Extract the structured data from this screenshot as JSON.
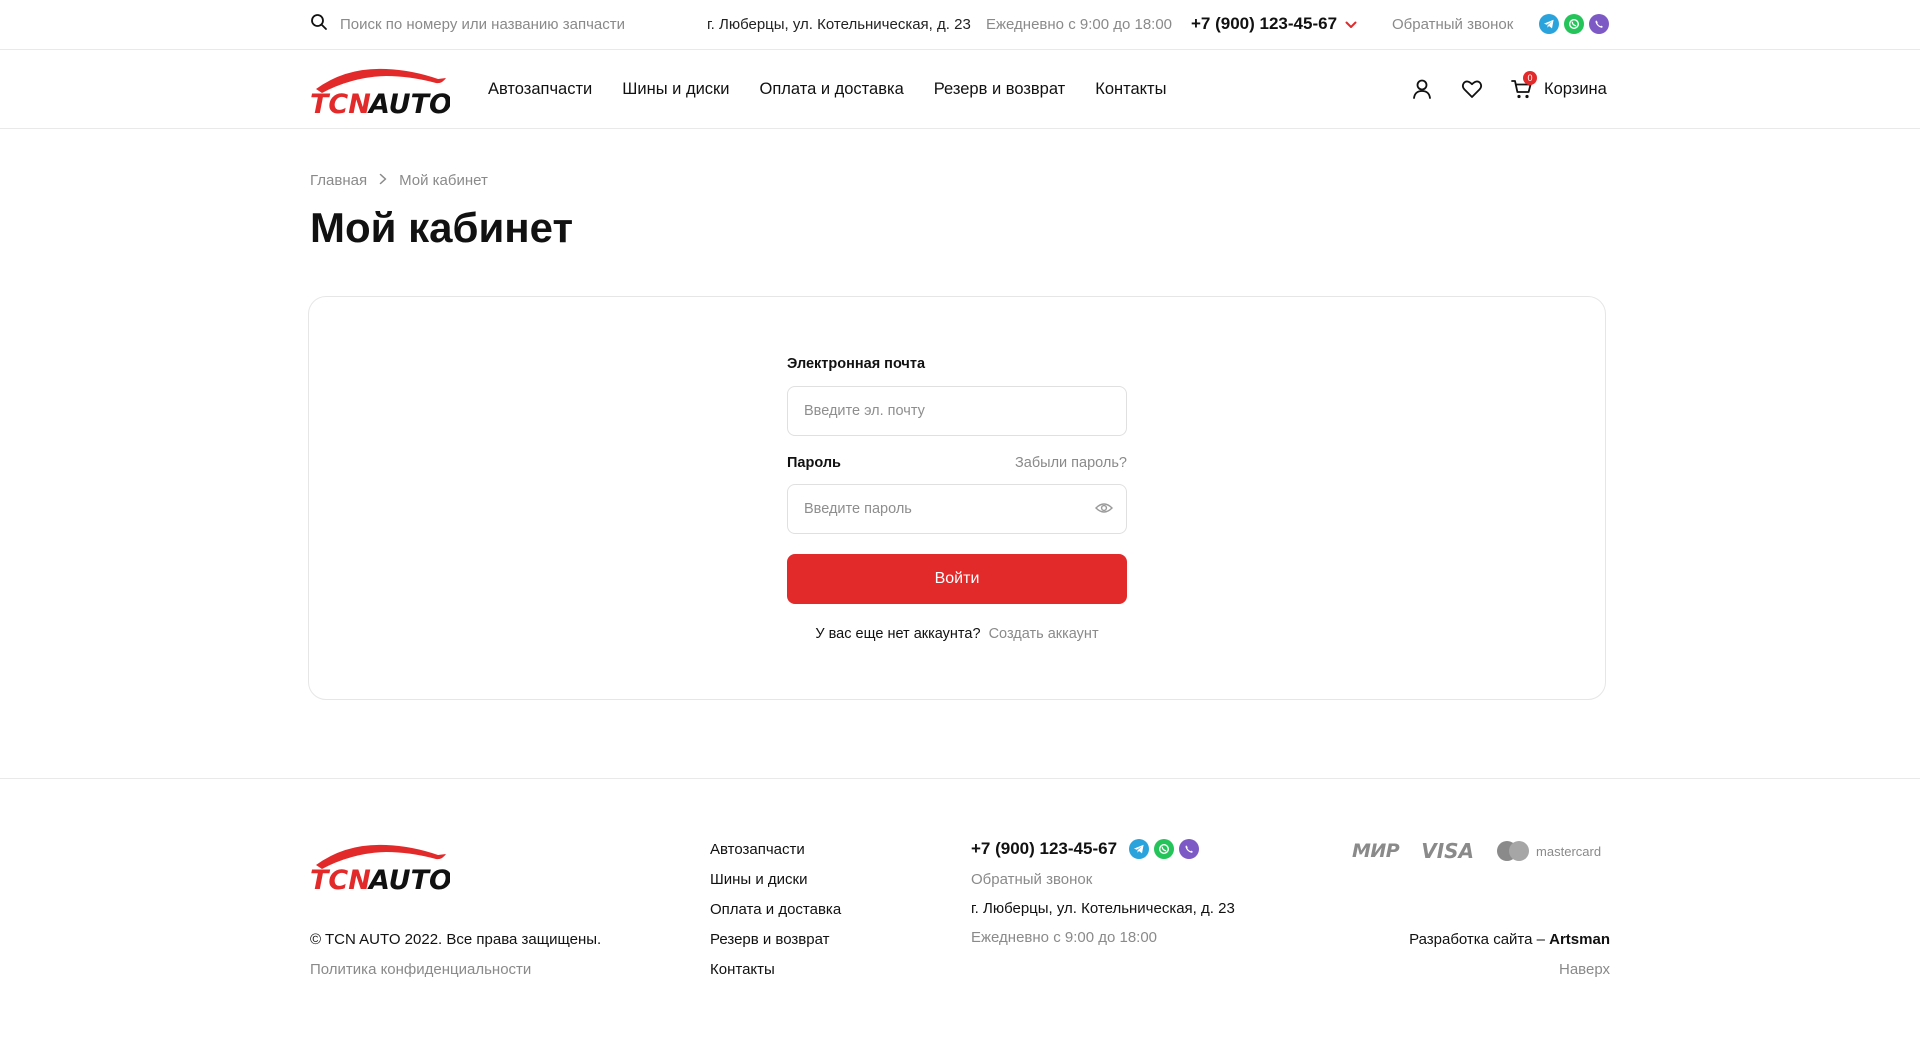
{
  "topbar": {
    "search_placeholder": "Поиск по номеру или названию запчасти",
    "address": "г. Люберцы, ул. Котельническая, д. 23",
    "hours": "Ежедневно с 9:00 до 18:00",
    "phone": "+7 (900) 123-45-67",
    "callback": "Обратный звонок",
    "socials": [
      "telegram-icon",
      "whatsapp-icon",
      "viber-icon"
    ]
  },
  "brand": {
    "logo_text": "TCNAUTO",
    "accent_color": "#e32a2a"
  },
  "nav": {
    "items": [
      "Автозапчасти",
      "Шины и диски",
      "Оплата и доставка",
      "Резерв и возврат",
      "Контакты"
    ]
  },
  "header": {
    "cart_label": "Корзина",
    "cart_count": "0"
  },
  "breadcrumb": {
    "home": "Главная",
    "current": "Мой кабинет"
  },
  "page": {
    "title": "Мой кабинет"
  },
  "login": {
    "email_label": "Электронная почта",
    "email_placeholder": "Введите эл. почту",
    "password_label": "Пароль",
    "forgot_link": "Забыли пароль?",
    "password_placeholder": "Введите пароль",
    "submit_label": "Войти",
    "no_account_text": "У вас еще нет аккаунта?",
    "create_account_link": "Создать аккаунт"
  },
  "footer": {
    "copyright": "© TCN AUTO 2022. Все права защищены.",
    "policy": "Политика конфиденциальности",
    "nav": [
      "Автозапчасти",
      "Шины и диски",
      "Оплата и доставка",
      "Резерв и возврат",
      "Контакты"
    ],
    "phone": "+7 (900) 123-45-67",
    "callback": "Обратный звонок",
    "address": "г. Люберцы, ул. Котельническая, д. 23",
    "hours": "Ежедневно с 9:00 до 18:00",
    "payments": [
      "МИР",
      "VISA",
      "mastercard"
    ],
    "dev_prefix": "Разработка сайта – ",
    "dev_name": "Artsman",
    "to_top": "Наверх"
  }
}
